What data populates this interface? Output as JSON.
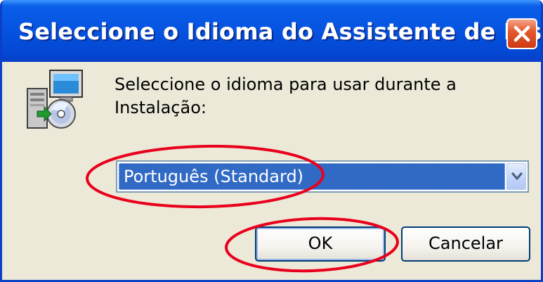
{
  "window": {
    "title": "Seleccione o Idioma do Assistente de Inst...",
    "close_icon": "close-icon"
  },
  "dialog": {
    "icon": "installer-computer-cd-icon",
    "prompt_line1": "Seleccione o idioma para usar durante a",
    "prompt_line2": "Instalação:"
  },
  "language_select": {
    "selected": "Português (Standard)",
    "arrow_icon": "chevron-down-icon"
  },
  "buttons": {
    "ok_label": "OK",
    "cancel_label": "Cancelar"
  },
  "colors": {
    "titlebar": "#0553e0",
    "selection": "#316ac5",
    "annotation": "#e8001c"
  }
}
